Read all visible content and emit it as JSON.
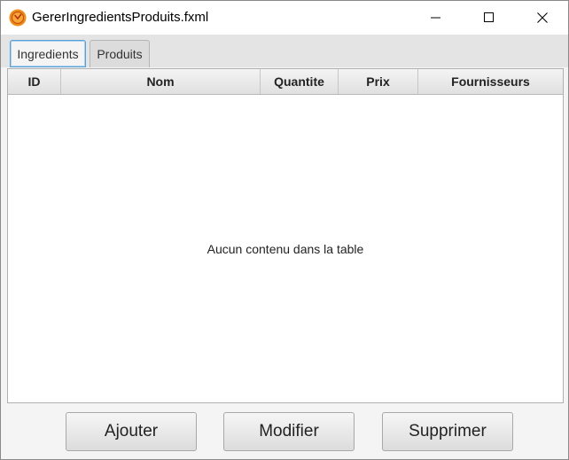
{
  "window": {
    "title": "GererIngredientsProduits.fxml",
    "app_icon": "java-fx-icon",
    "controls": {
      "minimize": "minimize-icon",
      "maximize": "maximize-icon",
      "close": "close-icon"
    }
  },
  "tabs": [
    {
      "label": "Ingredients",
      "active": true
    },
    {
      "label": "Produits",
      "active": false
    }
  ],
  "table": {
    "columns": [
      "ID",
      "Nom",
      "Quantite",
      "Prix",
      "Fournisseurs"
    ],
    "rows": [],
    "empty_message": "Aucun contenu dans la table"
  },
  "actions": {
    "add_label": "Ajouter",
    "edit_label": "Modifier",
    "delete_label": "Supprimer"
  },
  "colors": {
    "active_tab_border": "#5a9fd4",
    "app_icon": "#f08c1a"
  }
}
